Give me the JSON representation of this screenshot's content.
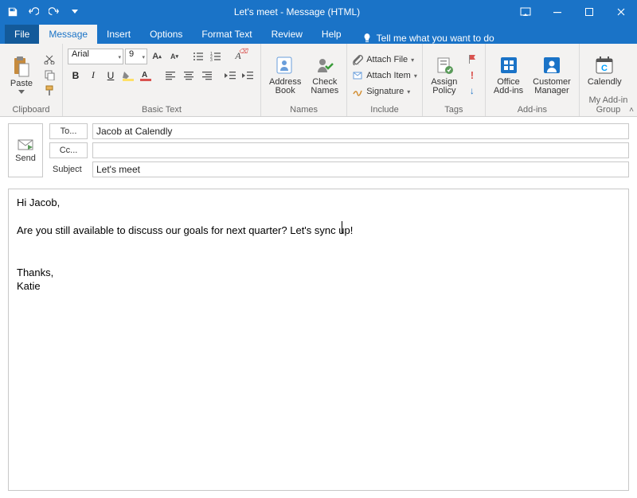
{
  "window": {
    "title": "Let's meet - Message (HTML)"
  },
  "tabs": {
    "file": "File",
    "message": "Message",
    "insert": "Insert",
    "options": "Options",
    "format_text": "Format Text",
    "review": "Review",
    "help": "Help",
    "tellme": "Tell me what you want to do"
  },
  "ribbon": {
    "clipboard": {
      "paste": "Paste",
      "label": "Clipboard"
    },
    "basic_text": {
      "font_name": "Arial",
      "font_size": "9",
      "bold": "B",
      "italic": "I",
      "underline": "U",
      "label": "Basic Text"
    },
    "names": {
      "address_book": "Address\nBook",
      "check_names": "Check\nNames",
      "label": "Names"
    },
    "include": {
      "attach_file": "Attach File",
      "attach_item": "Attach Item",
      "signature": "Signature",
      "label": "Include"
    },
    "tags": {
      "assign_policy": "Assign\nPolicy",
      "label": "Tags"
    },
    "addins": {
      "office": "Office\nAdd-ins",
      "customer": "Customer\nManager",
      "label": "Add-ins"
    },
    "myaddin": {
      "calendly": "Calendly",
      "label": "My Add-in Group"
    }
  },
  "compose": {
    "send": "Send",
    "to_label": "To...",
    "cc_label": "Cc...",
    "subject_label": "Subject",
    "to_value": "Jacob at Calendly",
    "cc_value": "",
    "subject_value": "Let's meet",
    "body_greeting": "Hi Jacob,",
    "body_line1": "Are you still available to discuss our goals for next quarter? Let's sync up!",
    "body_sign1": "Thanks,",
    "body_sign2": "Katie"
  },
  "colors": {
    "primary": "#1a73c7",
    "ribbon_bg": "#f3f2f1"
  }
}
